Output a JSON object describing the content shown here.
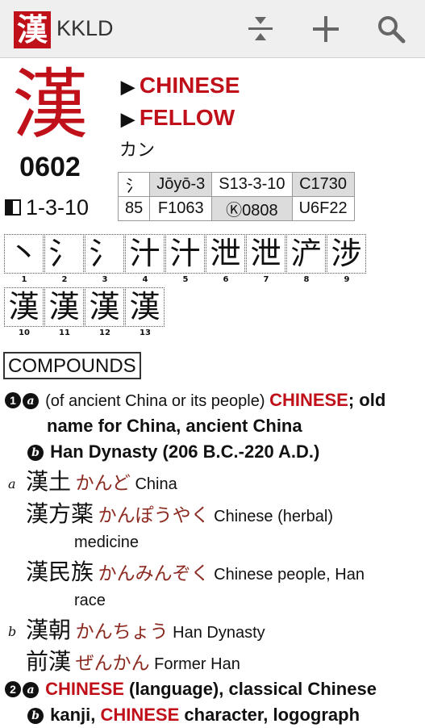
{
  "app": {
    "logo_char": "漢",
    "title": "KKLD"
  },
  "toolbar": {
    "icons": [
      "collapse-icon",
      "plus-icon",
      "search-icon"
    ]
  },
  "kanji": {
    "char": "漢",
    "number": "0602",
    "skip": "1-3-10",
    "meanings": [
      "CHINESE",
      "FELLOW"
    ],
    "reading": "カン",
    "info": [
      [
        "氵",
        "Jōyō-3",
        "S13-3-10",
        "C1730"
      ],
      [
        "85",
        "F1063",
        "Ⓚ0808",
        "U6F22"
      ]
    ]
  },
  "strokes": [
    {
      "n": "1",
      "g": "丶"
    },
    {
      "n": "2",
      "g": "氵"
    },
    {
      "n": "3",
      "g": "氵"
    },
    {
      "n": "4",
      "g": "汁"
    },
    {
      "n": "5",
      "g": "汁"
    },
    {
      "n": "6",
      "g": "泄"
    },
    {
      "n": "7",
      "g": "泄"
    },
    {
      "n": "8",
      "g": "浐"
    },
    {
      "n": "9",
      "g": "涉"
    },
    {
      "n": "10",
      "g": "漢"
    },
    {
      "n": "11",
      "g": "漢"
    },
    {
      "n": "12",
      "g": "漢"
    },
    {
      "n": "13",
      "g": "漢"
    }
  ],
  "section": {
    "label": "COMPOUNDS"
  },
  "senses": {
    "s1_markers": [
      "1",
      "a"
    ],
    "s1_pre": "(of ancient China or its people) ",
    "s1_red": "CHINESE",
    "s1_post": "; old",
    "s1_line2": "name for China, ancient China",
    "s1b_marker": "b",
    "s1b_text": "Han Dynasty (206 B.C.-220 A.D.)",
    "s2_markers": [
      "2",
      "a"
    ],
    "s2_red": "CHINESE",
    "s2_post": " (language), classical Chinese",
    "s2b_marker": "b",
    "s2b_pre": "kanji, ",
    "s2b_red": "CHINESE",
    "s2b_post": " character, logograph"
  },
  "compounds": [
    {
      "tag": "a",
      "word": "漢土",
      "reading": "かんど",
      "gloss": "China",
      "cont": ""
    },
    {
      "tag": "",
      "word": "漢方薬",
      "reading": "かんぽうやく",
      "gloss": "Chinese (herbal)",
      "cont": "medicine"
    },
    {
      "tag": "",
      "word": "漢民族",
      "reading": "かんみんぞく",
      "gloss": "Chinese people, Han",
      "cont": "race"
    },
    {
      "tag": "b",
      "word": "漢朝",
      "reading": "かんちょう",
      "gloss": "Han Dynasty",
      "cont": ""
    },
    {
      "tag": "",
      "word": "前漢",
      "reading": "ぜんかん",
      "gloss": "Former Han",
      "cont": ""
    }
  ]
}
